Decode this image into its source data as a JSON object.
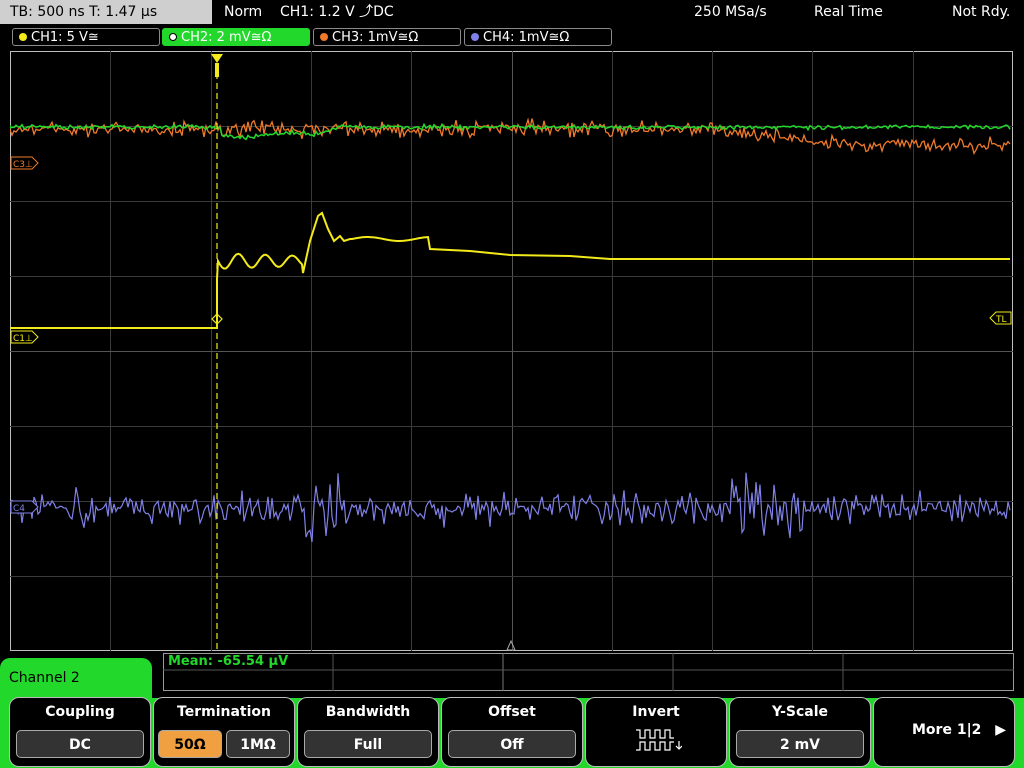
{
  "topbar": {
    "timebase": "TB: 500 ns   T: 1.47 µs",
    "mode": "Norm",
    "trigger": "CH1: 1.2 V ⤴DC",
    "sample_rate": "250 MSa/s",
    "acq_mode": "Real Time",
    "status": "Not Rdy."
  },
  "channels": [
    {
      "label": "CH1: 5 V≅",
      "color": "#f2ea1a"
    },
    {
      "label": "CH2: 2 mV≅Ω",
      "color": "#22d82b"
    },
    {
      "label": "CH3: 1mV≅Ω",
      "color": "#f07a2a"
    },
    {
      "label": "CH4: 1mV≅Ω",
      "color": "#8080e8"
    }
  ],
  "markers": {
    "c3": "C3⊥",
    "c1": "C1⊥",
    "c4": "C4",
    "tl": "TL",
    "trig": "T"
  },
  "measurement": {
    "text": "Mean: -65.54 µV"
  },
  "panel_tab": "Channel 2",
  "softkeys": {
    "coupling": {
      "title": "Coupling",
      "value": "DC"
    },
    "termination": {
      "title": "Termination",
      "opt1": "50Ω",
      "opt2": "1MΩ",
      "selected": "50Ω"
    },
    "bandwidth": {
      "title": "Bandwidth",
      "value": "Full"
    },
    "offset": {
      "title": "Offset",
      "value": "Off"
    },
    "invert": {
      "title": "Invert",
      "icon": "invert-waveform-icon"
    },
    "yscale": {
      "title": "Y-Scale",
      "value": "2 mV"
    },
    "more": {
      "label": "More 1|2",
      "icon": "play-arrow-icon"
    }
  }
}
